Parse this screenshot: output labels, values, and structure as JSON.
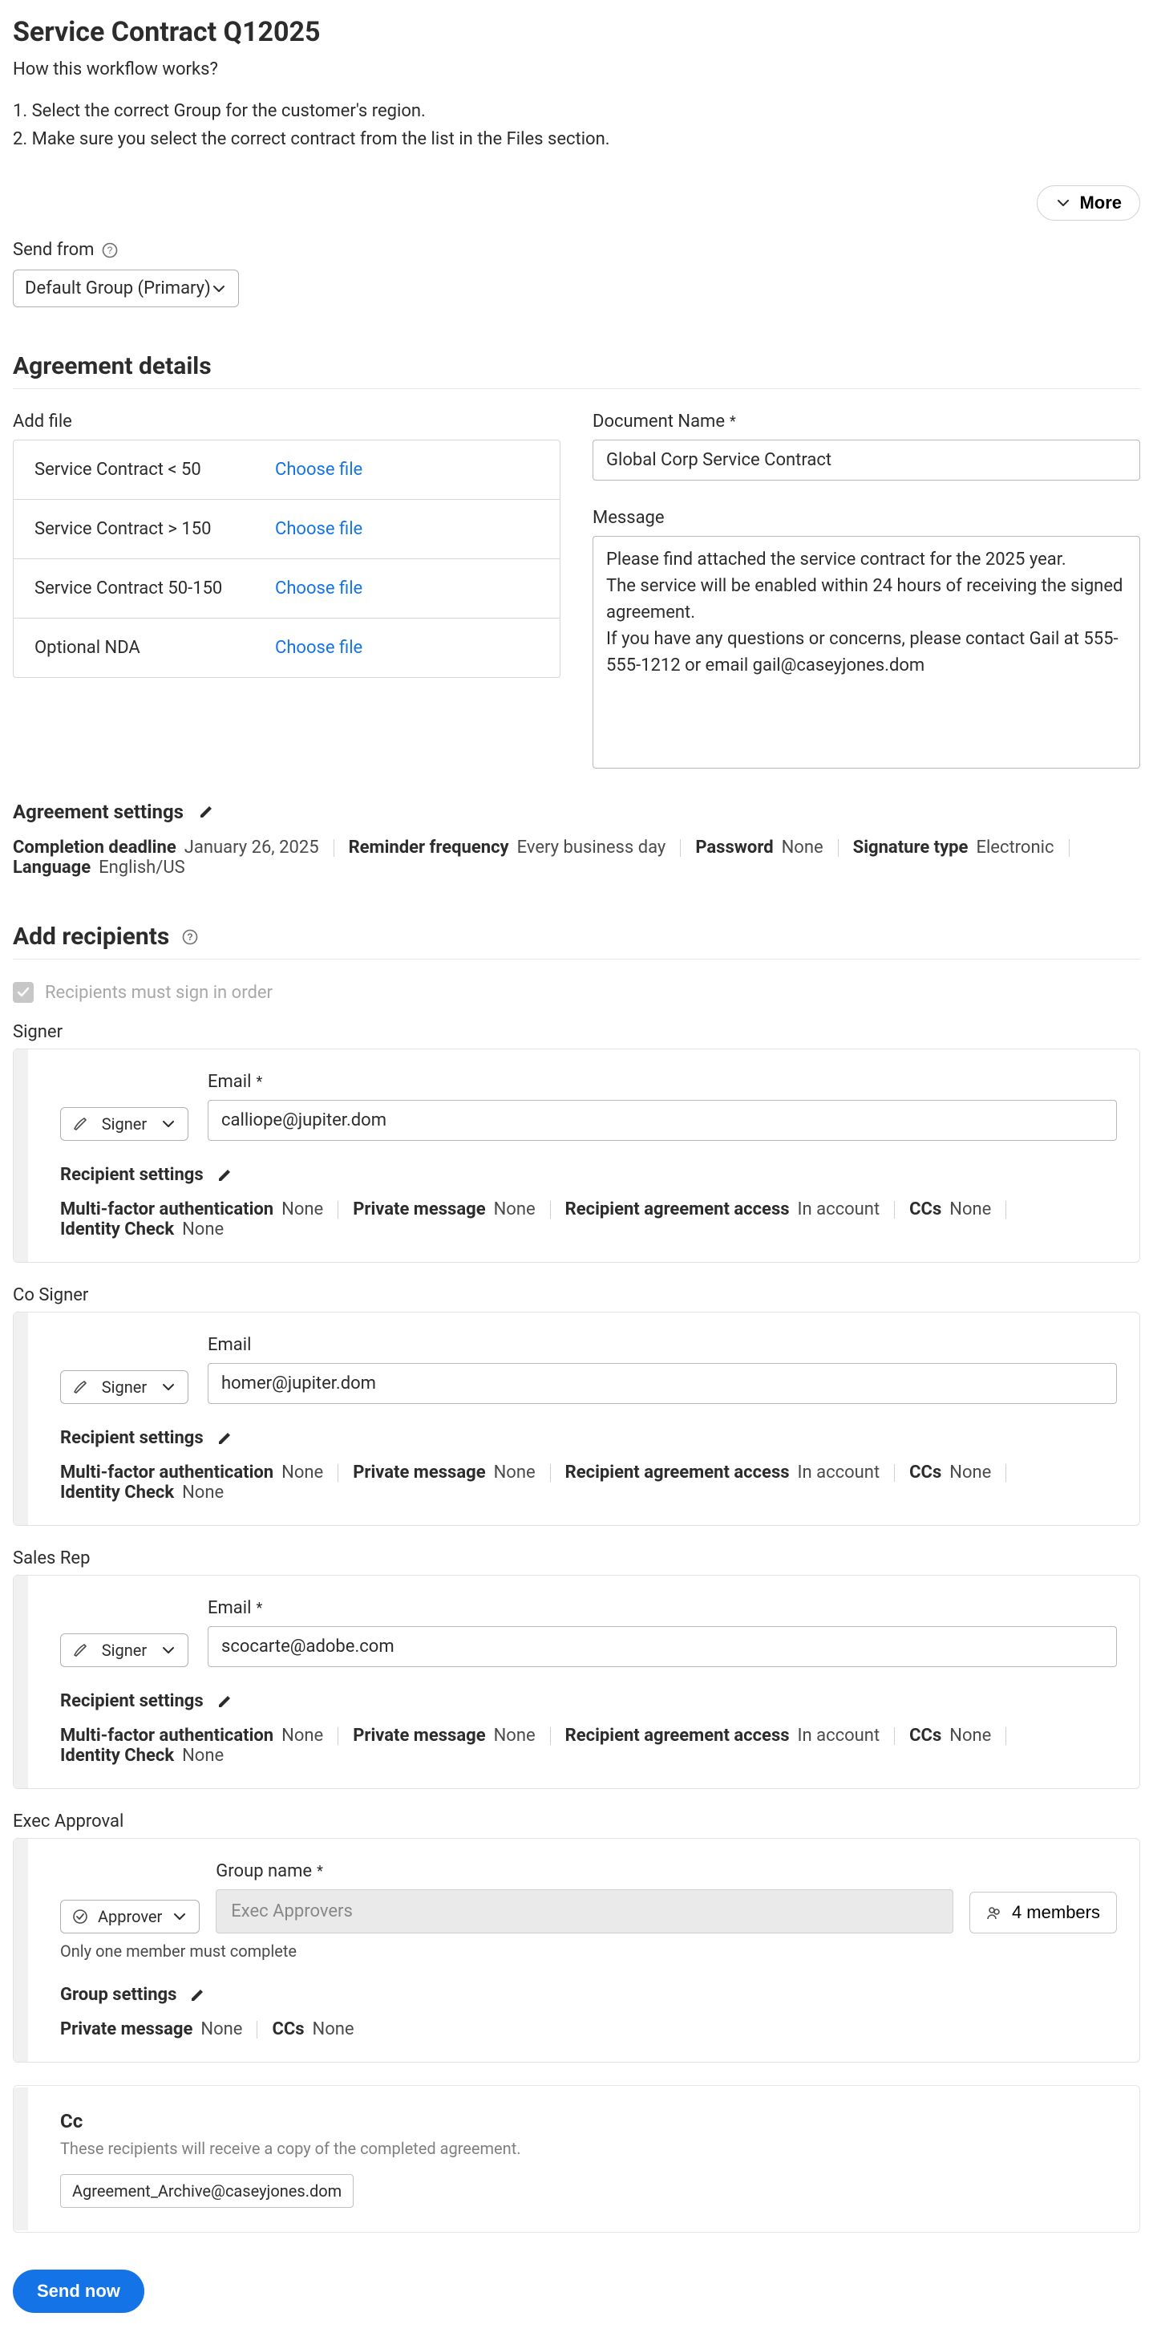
{
  "page": {
    "title": "Service Contract Q12025",
    "how": "How this workflow works?",
    "steps": [
      "1. Select the correct Group for the customer's region.",
      "2. Make sure you select the correct contract from the list in the Files section."
    ],
    "more": "More"
  },
  "sendFrom": {
    "label": "Send from",
    "value": "Default Group (Primary)"
  },
  "agreement": {
    "heading": "Agreement details",
    "addFileLabel": "Add file",
    "chooseFile": "Choose file",
    "files": [
      {
        "name": "Service Contract  <  50"
      },
      {
        "name": "Service Contract  >  150"
      },
      {
        "name": "Service Contract 50-150"
      },
      {
        "name": "Optional NDA"
      }
    ],
    "docNameLabel": "Document Name",
    "docNameValue": "Global Corp Service Contract",
    "messageLabel": "Message",
    "messageValue": "Please find attached the service contract for the 2025 year.\nThe service will be enabled within 24 hours of receiving the signed agreement.\nIf you have any questions or concerns, please contact Gail at 555-555-1212 or email gail@caseyjones.dom"
  },
  "agreementSettings": {
    "heading": "Agreement settings",
    "items": {
      "deadlineK": "Completion deadline",
      "deadlineV": "January 26, 2025",
      "reminderK": "Reminder frequency",
      "reminderV": "Every business day",
      "passwordK": "Password",
      "passwordV": "None",
      "sigK": "Signature type",
      "sigV": "Electronic",
      "langK": "Language",
      "langV": "English/US"
    }
  },
  "recipients": {
    "heading": "Add recipients",
    "orderLabel": "Recipients must sign in order",
    "emailLabel": "Email",
    "groupNameLabel": "Group name",
    "roleSigner": "Signer",
    "roleApprover": "Approver",
    "recipSettingsHeading": "Recipient settings",
    "groupSettingsHeading": "Group settings",
    "onlyOneNote": "Only one member must complete",
    "membersLabel": "4 members",
    "execPlaceholder": "Exec Approvers",
    "settings": {
      "mfaK": "Multi-factor authentication",
      "mfaV": "None",
      "pmK": "Private message",
      "pmV": "None",
      "raaK": "Recipient agreement access",
      "raaV": "In account",
      "ccsK": "CCs",
      "ccsV": "None",
      "idK": "Identity Check",
      "idV": "None"
    },
    "list": [
      {
        "title": "Signer",
        "role": "Signer",
        "emailRequired": true,
        "email": "calliope@jupiter.dom"
      },
      {
        "title": "Co Signer",
        "role": "Signer",
        "emailRequired": false,
        "email": "homer@jupiter.dom"
      },
      {
        "title": "Sales Rep",
        "role": "Signer",
        "emailRequired": true,
        "email": "scocarte@adobe.com"
      }
    ],
    "exec": {
      "title": "Exec Approval"
    }
  },
  "cc": {
    "heading": "Cc",
    "desc": "These recipients will receive a copy of the completed agreement.",
    "chip": "Agreement_Archive@caseyjones.dom"
  },
  "send": {
    "label": "Send now"
  }
}
